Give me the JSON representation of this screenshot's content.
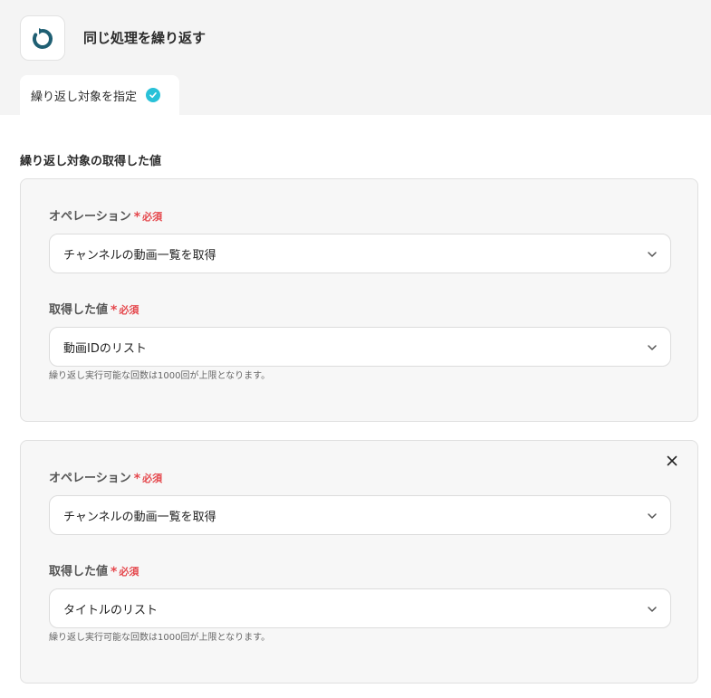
{
  "header": {
    "title": "同じ処理を繰り返す",
    "tab_label": "繰り返し対象を指定"
  },
  "section_title": "繰り返し対象の取得した値",
  "required_text": "必須",
  "required_star": "*",
  "cards": [
    {
      "operation_label": "オペレーション",
      "operation_value": "チャンネルの動画一覧を取得",
      "value_label": "取得した値",
      "value_value": "動画IDのリスト",
      "help": "繰り返し実行可能な回数は1000回が上限となります。"
    },
    {
      "operation_label": "オペレーション",
      "operation_value": "チャンネルの動画一覧を取得",
      "value_label": "取得した値",
      "value_value": "タイトルのリスト",
      "help": "繰り返し実行可能な回数は1000回が上限となります。"
    }
  ],
  "colors": {
    "accent": "#29c1d8",
    "icon": "#1f5f73",
    "required": "#e5484d"
  }
}
